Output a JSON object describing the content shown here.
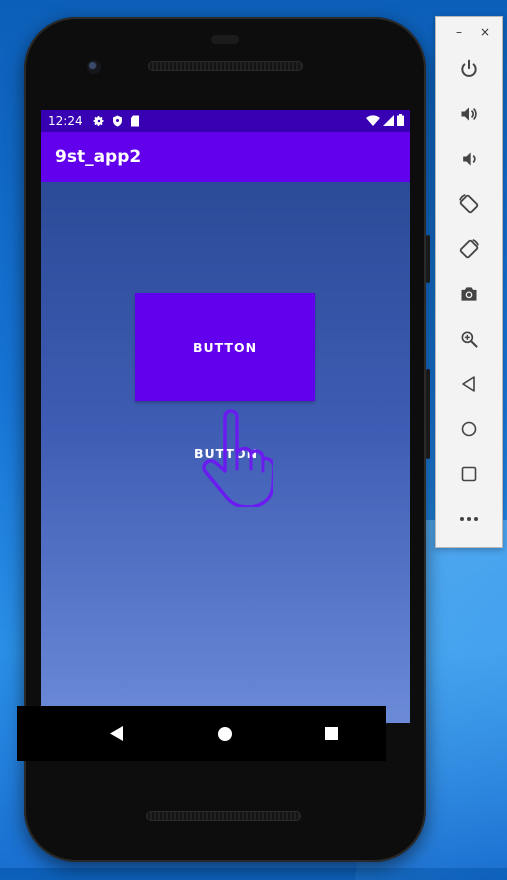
{
  "device": {
    "status_bar": {
      "time": "12:24",
      "left_icons": [
        "gear-icon",
        "shield-icon",
        "sd-card-icon"
      ],
      "right_icons": [
        "wifi-icon",
        "signal-icon",
        "battery-icon"
      ],
      "color": "#3700b3"
    },
    "app_bar": {
      "title": "9st_app2",
      "color": "#6200ee"
    },
    "main": {
      "primary_button_label": "BUTTON",
      "text_button_label": "BUTTON",
      "background_top": "#2b4b98",
      "background_bottom": "#6b8ad8"
    },
    "nav_bar": [
      "back-icon",
      "home-icon",
      "recents-icon"
    ]
  },
  "emulator_toolbar": {
    "window_controls": [
      "minimize",
      "close"
    ],
    "window_glyphs": {
      "minimize": "–",
      "close": "×"
    },
    "items": [
      "power-icon",
      "volume-up-icon",
      "volume-down-icon",
      "rotate-left-icon",
      "rotate-right-icon",
      "screenshot-icon",
      "zoom-icon",
      "back-icon",
      "home-icon",
      "overview-icon",
      "more-icon"
    ]
  }
}
